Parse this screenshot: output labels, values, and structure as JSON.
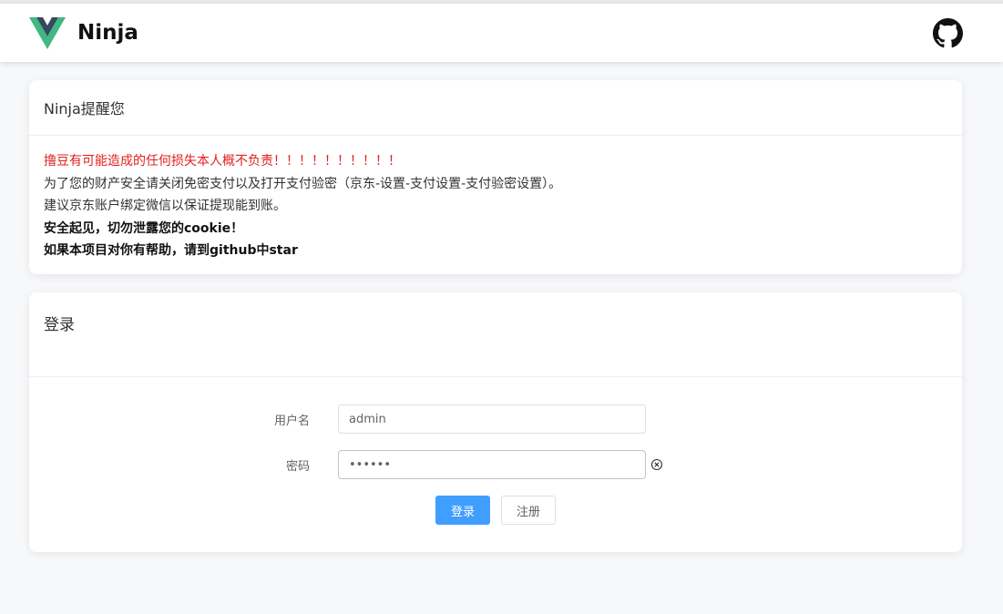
{
  "header": {
    "app_name": "Ninja",
    "logo_icon": "vue-logo-icon",
    "github_icon": "github-icon"
  },
  "notice": {
    "title": "Ninja提醒您",
    "lines": [
      {
        "text": "撸豆有可能造成的任何损失本人概不负责！！！！！！！！！！",
        "style": "red"
      },
      {
        "text": "为了您的财产安全请关闭免密支付以及打开支付验密（京东-设置-支付设置-支付验密设置）。",
        "style": "normal"
      },
      {
        "text": "建议京东账户绑定微信以保证提现能到账。",
        "style": "normal"
      },
      {
        "text": "安全起见，切勿泄露您的cookie！",
        "style": "bold"
      },
      {
        "text": "如果本项目对你有帮助，请到github中star",
        "style": "bold"
      }
    ]
  },
  "login": {
    "title": "登录",
    "username_label": "用户名",
    "username_value": "admin",
    "password_label": "密码",
    "password_value": "••••••",
    "clear_icon": "circle-close-icon",
    "login_button": "登录",
    "register_button": "注册"
  },
  "colors": {
    "primary": "#409eff",
    "warning_text": "#e02020",
    "vue_green": "#41b883",
    "vue_dark": "#35495e"
  }
}
